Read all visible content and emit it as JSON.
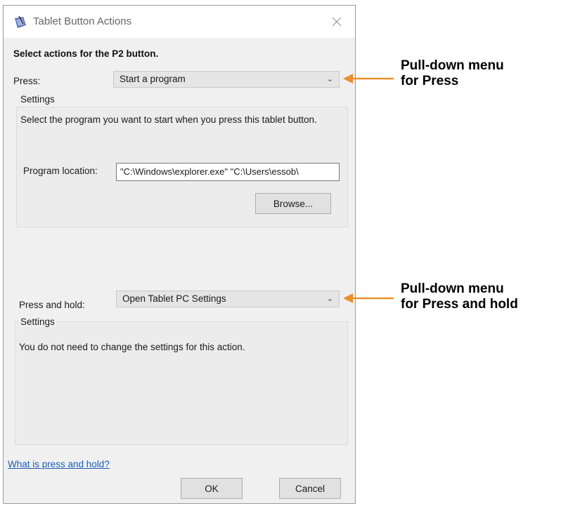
{
  "dialog": {
    "title": "Tablet Button Actions",
    "heading": "Select actions for the P2 button.",
    "press": {
      "label": "Press:",
      "selected": "Start a program",
      "group_title": "Settings",
      "description": "Select the program you want to start when you press this tablet button.",
      "program_location_label": "Program location:",
      "program_location_value": "\"C:\\Windows\\explorer.exe\" \"C:\\Users\\essob\\",
      "browse_label": "Browse..."
    },
    "press_and_hold": {
      "label": "Press and hold:",
      "selected": "Open Tablet PC Settings",
      "group_title": "Settings",
      "description": "You do not need to change the settings for this action."
    },
    "help_link": "What is press and hold?",
    "ok_label": "OK",
    "cancel_label": "Cancel"
  },
  "callouts": {
    "press": "Pull-down menu for Press",
    "press_line1": "Pull-down menu",
    "press_line2": "for Press",
    "hold_line1": "Pull-down menu",
    "hold_line2": "for Press and hold"
  },
  "colors": {
    "arrow": "#e8912d",
    "link": "#1a5fb4"
  }
}
